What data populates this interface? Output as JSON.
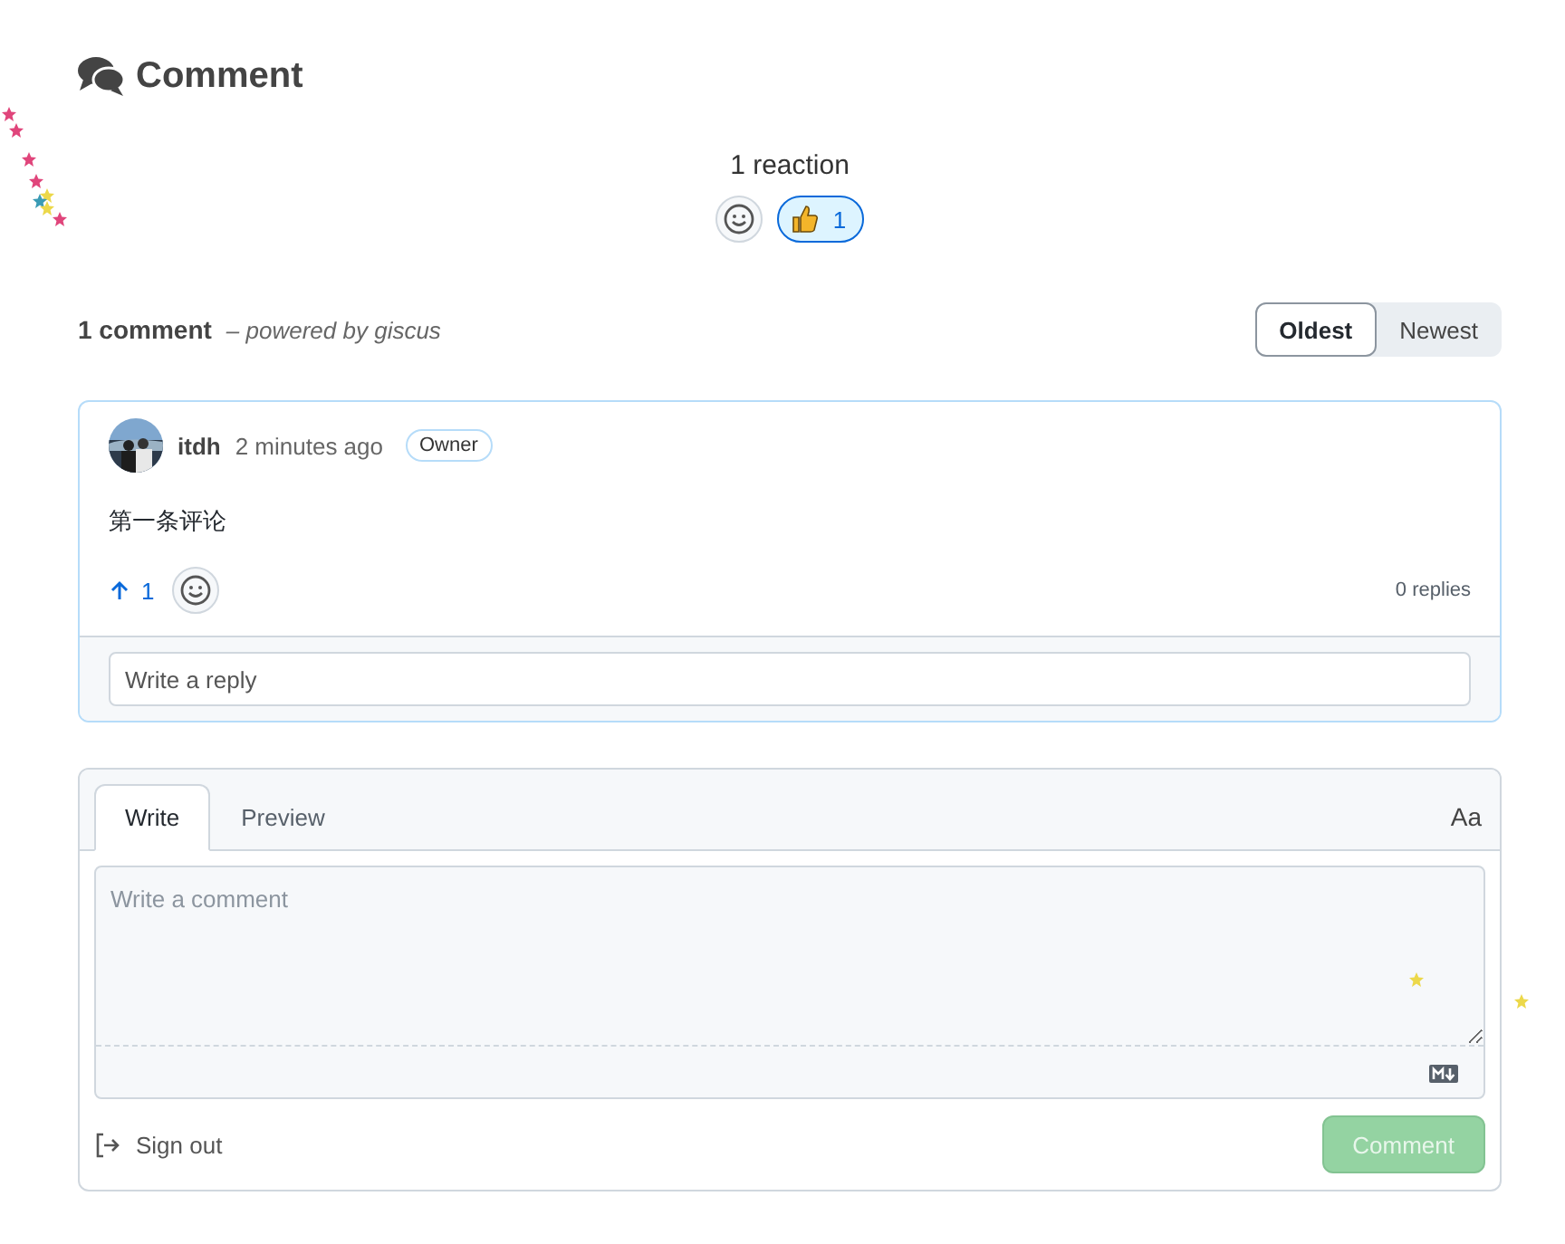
{
  "header": {
    "title": "Comment"
  },
  "reactions": {
    "summary": "1 reaction",
    "items": [
      {
        "count": "1",
        "selected": true
      }
    ]
  },
  "thread": {
    "count": "1 comment",
    "powered_by": "– powered by giscus",
    "sort": [
      {
        "label": "Oldest",
        "selected": true
      },
      {
        "label": "Newest",
        "selected": false
      }
    ]
  },
  "comments": [
    {
      "author": "itdh",
      "time": "2 minutes ago",
      "badge": "Owner",
      "body": "第一条评论",
      "upvotes": "1",
      "upvoted": true,
      "replies": "0 replies",
      "reply_placeholder": "Write a reply"
    }
  ],
  "composer": {
    "tabs": [
      {
        "label": "Write",
        "selected": true
      },
      {
        "label": "Preview",
        "selected": false
      }
    ],
    "font_toggle": "Aa",
    "placeholder": "Write a comment",
    "sign_out": "Sign out",
    "submit": {
      "label": "Comment",
      "disabled": true
    }
  }
}
